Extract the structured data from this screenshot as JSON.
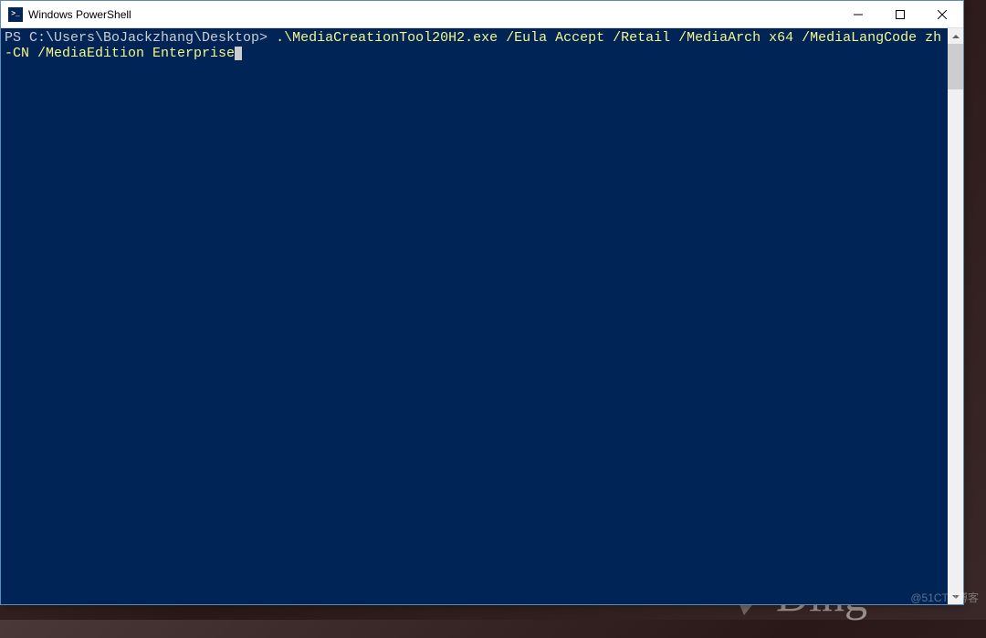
{
  "window": {
    "title": "Windows PowerShell"
  },
  "terminal": {
    "prompt": "PS C:\\Users\\BoJackzhang\\Desktop> ",
    "command": ".\\MediaCreationTool20H2.exe /Eula Accept /Retail /MediaArch x64 /MediaLangCode zh-CN /MediaEdition Enterprise"
  },
  "watermark": "@51CTO博客"
}
